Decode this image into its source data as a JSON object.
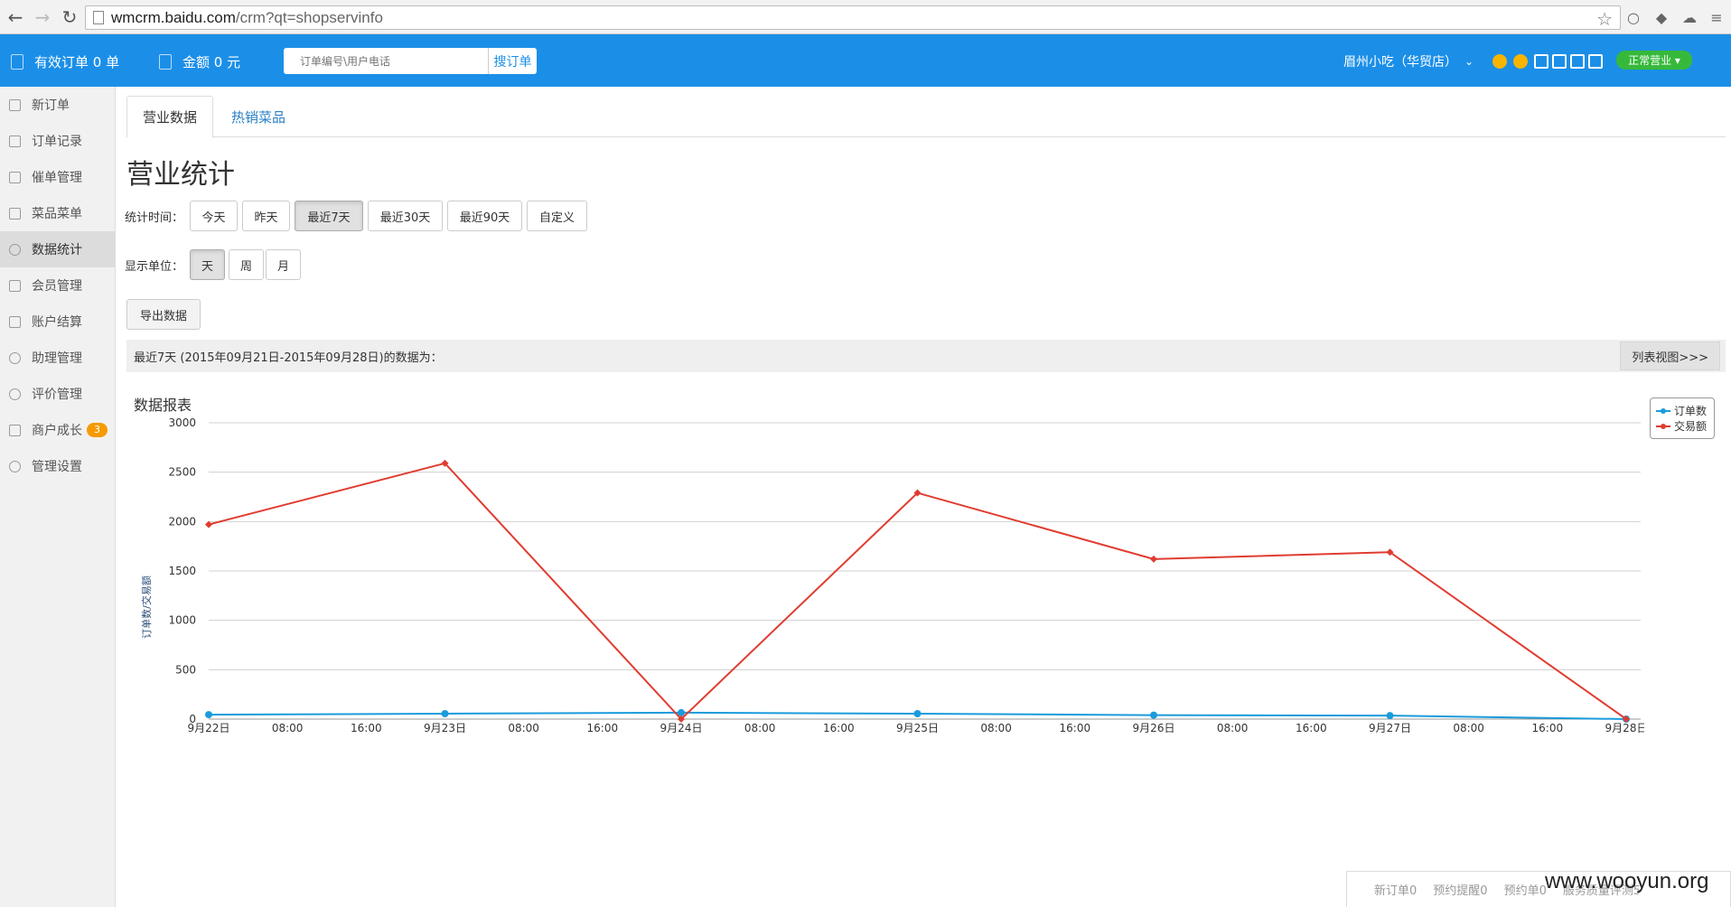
{
  "browser": {
    "url_host": "wmcrm.baidu.com",
    "url_path": "/crm?qt=shopservinfo"
  },
  "topbar": {
    "orders_label": "有效订单 0 单",
    "amount_label": "金额 0 元",
    "search_placeholder": "订单编号\\用户电话",
    "search_button": "搜订单",
    "shop_name": "眉州小吃（华贸店）",
    "status": "正常营业"
  },
  "sidebar": {
    "items": [
      {
        "label": "新订单"
      },
      {
        "label": "订单记录"
      },
      {
        "label": "催单管理"
      },
      {
        "label": "菜品菜单"
      },
      {
        "label": "数据统计"
      },
      {
        "label": "会员管理"
      },
      {
        "label": "账户结算"
      },
      {
        "label": "助理管理"
      },
      {
        "label": "评价管理"
      },
      {
        "label": "商户成长",
        "badge": "3"
      },
      {
        "label": "管理设置"
      }
    ]
  },
  "tabs": [
    "营业数据",
    "热销菜品"
  ],
  "page_title": "营业统计",
  "time_filter": {
    "label": "统计时间：",
    "options": [
      "今天",
      "昨天",
      "最近7天",
      "最近30天",
      "最近90天",
      "自定义"
    ],
    "selected": "最近7天"
  },
  "unit_filter": {
    "label": "显示单位：",
    "options": [
      "天",
      "周",
      "月"
    ],
    "selected": "天"
  },
  "export_button": "导出数据",
  "info_bar": {
    "text": "最近7天 (2015年09月21日-2015年09月28日)的数据为：",
    "list_view": "列表视图>>>"
  },
  "chart_data": {
    "type": "line",
    "title": "数据报表",
    "ylabel": "订单数/交易额",
    "ylim": [
      0,
      3000
    ],
    "y_ticks": [
      0,
      500,
      1000,
      1500,
      2000,
      2500,
      3000
    ],
    "x_tick_labels": [
      "9月22日",
      "08:00",
      "16:00",
      "9月23日",
      "08:00",
      "16:00",
      "9月24日",
      "08:00",
      "16:00",
      "9月25日",
      "08:00",
      "16:00",
      "9月26日",
      "08:00",
      "16:00",
      "9月27日",
      "08:00",
      "16:00",
      "9月28日"
    ],
    "categories": [
      "9月22日",
      "9月23日",
      "9月24日",
      "9月25日",
      "9月26日",
      "9月27日",
      "9月28日"
    ],
    "series": [
      {
        "name": "订单数",
        "color": "#1a9bdc",
        "values": [
          45,
          55,
          65,
          55,
          40,
          35,
          0
        ]
      },
      {
        "name": "交易额",
        "color": "#e03c31",
        "values": [
          1970,
          2590,
          0,
          2290,
          1620,
          1690,
          0
        ]
      }
    ],
    "grid": true,
    "legend": "top-right"
  },
  "footer": {
    "items": [
      "新订单0",
      "预约提醒0",
      "预约单0",
      "服务质量评测5"
    ],
    "watermark": "www.wooyun.org"
  }
}
